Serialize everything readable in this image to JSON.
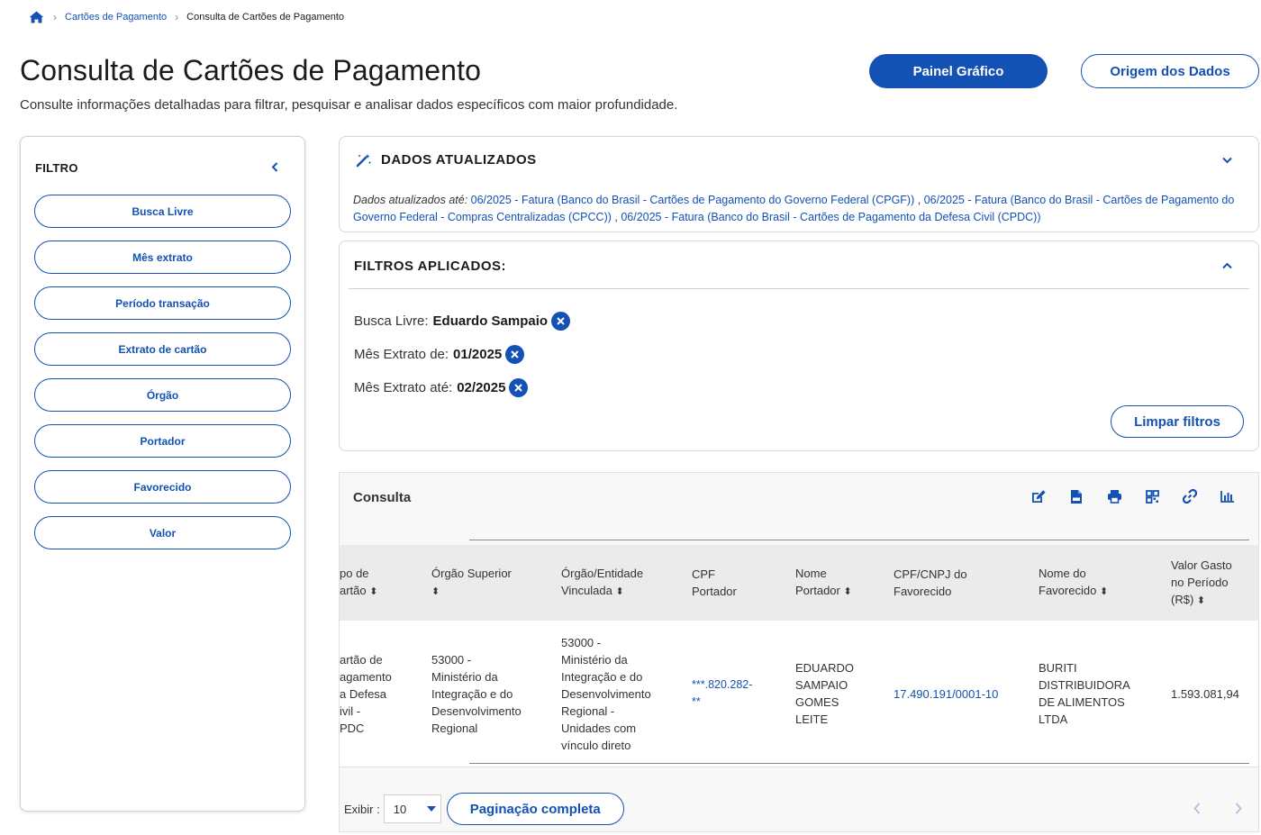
{
  "breadcrumb": {
    "home_icon": "home-icon",
    "items": [
      "Cartões de Pagamento",
      "Consulta de Cartões de Pagamento"
    ]
  },
  "header": {
    "title": "Consulta de Cartões de Pagamento",
    "subtitle": "Consulte informações detalhadas para filtrar, pesquisar e analisar dados específicos com maior profundidade.",
    "painel_button": "Painel Gráfico",
    "origem_button": "Origem dos Dados"
  },
  "filter": {
    "title": "FILTRO",
    "items": [
      "Busca Livre",
      "Mês extrato",
      "Período transação",
      "Extrato de cartão",
      "Órgão",
      "Portador",
      "Favorecido",
      "Valor"
    ]
  },
  "dados": {
    "title": "DADOS ATUALIZADOS",
    "label": "Dados atualizados até:",
    "entries": [
      "06/2025 - Fatura (Banco do Brasil - Cartões de Pagamento do Governo Federal (CPGF))",
      "06/2025 - Fatura (Banco do Brasil - Cartões de Pagamento do Governo Federal - Compras Centralizadas (CPCC))",
      "06/2025 - Fatura (Banco do Brasil - Cartões de Pagamento da Defesa Civil (CPDC))"
    ]
  },
  "filtros": {
    "title": "FILTROS APLICADOS:",
    "applied": [
      {
        "label": "Busca Livre:",
        "value": "Eduardo Sampaio"
      },
      {
        "label": "Mês Extrato de:",
        "value": "01/2025"
      },
      {
        "label": "Mês Extrato até:",
        "value": "02/2025"
      }
    ],
    "clear_button": "Limpar filtros"
  },
  "consulta": {
    "title": "Consulta",
    "toolbar_icons": [
      "edit-icon",
      "csv-file-icon",
      "print-icon",
      "qr-code-icon",
      "link-icon",
      "bar-chart-icon"
    ],
    "columns": [
      {
        "line1": "po de",
        "line2": "artão",
        "sort": true
      },
      {
        "line1": "Órgão Superior",
        "line2": "",
        "sort": true
      },
      {
        "line1": "Órgão/Entidade",
        "line2": "Vinculada",
        "sort": true
      },
      {
        "line1": "CPF",
        "line2": "Portador",
        "sort": false
      },
      {
        "line1": "Nome",
        "line2": "Portador",
        "sort": true
      },
      {
        "line1": "CPF/CNPJ do",
        "line2": "Favorecido",
        "sort": false
      },
      {
        "line1": "Nome do",
        "line2": "Favorecido",
        "sort": true
      },
      {
        "line1": "Valor Gasto",
        "line2": "no Período",
        "line3": "(R$)",
        "sort": true
      }
    ],
    "row": {
      "tipo": [
        "artão de",
        "agamento",
        "a Defesa",
        "ivil -",
        "PDC"
      ],
      "orgao_superior": [
        "53000 -",
        "Ministério da",
        "Integração e do",
        "Desenvolvimento",
        "Regional"
      ],
      "orgao_entidade": [
        "53000 -",
        "Ministério da",
        "Integração e do",
        "Desenvolvimento",
        "Regional -",
        "Unidades com",
        "vínculo direto"
      ],
      "cpf": [
        "***.820.282-",
        "**"
      ],
      "nome_portador": [
        "EDUARDO",
        "SAMPAIO",
        "GOMES",
        "LEITE"
      ],
      "cnpj_favorecido": "17.490.191/0001-10",
      "nome_favorecido": [
        "BURITI",
        "DISTRIBUIDORA",
        "DE ALIMENTOS",
        "LTDA"
      ],
      "valor": "1.593.081,94"
    },
    "pagination": {
      "exibir_label": "Exibir :",
      "page_size": "10",
      "full_button": "Paginação completa"
    }
  },
  "colors": {
    "primary": "#1351b4",
    "text": "#1b1b1b"
  }
}
